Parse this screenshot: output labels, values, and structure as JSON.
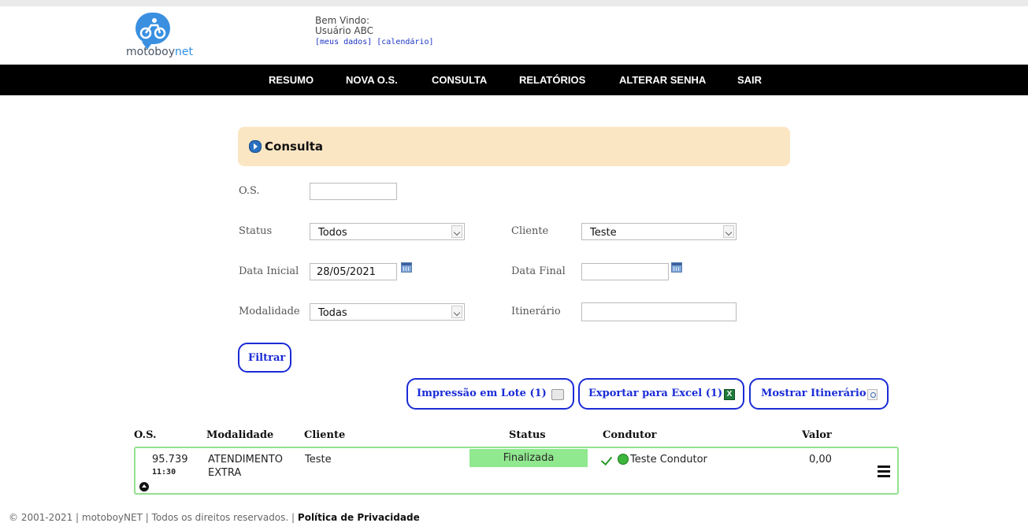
{
  "header": {
    "logo_text_main": "motoboy",
    "logo_text_accent": "net",
    "welcome_label": "Bem Vindo:",
    "user_name": "Usuário ABC",
    "link_my_data": "[meus dados]",
    "link_calendar": "[calendário]"
  },
  "nav": {
    "items": [
      "RESUMO",
      "NOVA O.S.",
      "CONSULTA",
      "RELATÓRIOS",
      "ALTERAR SENHA",
      "SAIR"
    ]
  },
  "panel": {
    "title": "Consulta"
  },
  "form": {
    "os_label": "O.S.",
    "os_value": "",
    "status_label": "Status",
    "status_value": "Todos",
    "cliente_label": "Cliente",
    "cliente_value": "Teste",
    "data_inicial_label": "Data Inicial",
    "data_inicial_value": "28/05/2021",
    "data_final_label": "Data Final",
    "data_final_value": "",
    "modalidade_label": "Modalidade",
    "modalidade_value": "Todas",
    "itinerario_label": "Itinerário",
    "itinerario_value": "",
    "filter_button": "Filtrar"
  },
  "actions": {
    "print_batch": "Impressão em Lote (1)",
    "export_excel": "Exportar para Excel (1)",
    "show_itinerary": "Mostrar Itinerário",
    "excel_icon_glyph": "X"
  },
  "table": {
    "headers": [
      "O.S.",
      "Modalidade",
      "Cliente",
      "Status",
      "Condutor",
      "Valor"
    ],
    "rows": [
      {
        "os": "95.739",
        "time": "11:30",
        "modalidade_line1": "ATENDIMENTO",
        "modalidade_line2": "EXTRA",
        "cliente": "Teste",
        "status": "Finalizada",
        "condutor": "Teste Condutor",
        "valor": "0,00"
      }
    ]
  },
  "footer": {
    "copyright": "© 2001-2021 | motoboyNET | Todos os direitos reservados. |",
    "privacy_link": "Política de Privacidade"
  },
  "colors": {
    "nav_bg": "#000000",
    "panel_bg": "#fbe6c4",
    "button_border": "#1a2bd6",
    "status_green": "#90e88f",
    "row_border": "#92e28f",
    "link_blue": "#1d35c6"
  }
}
